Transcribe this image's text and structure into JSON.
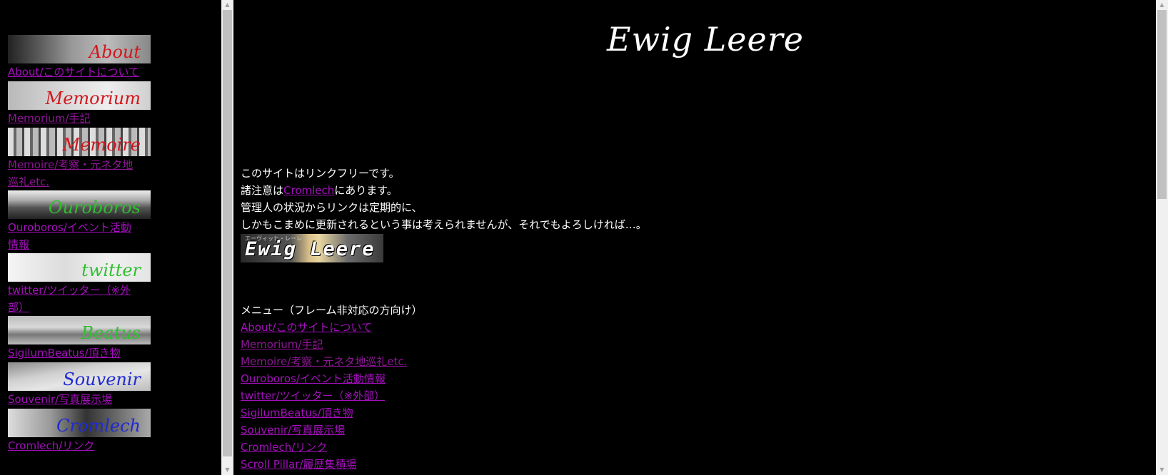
{
  "left_nav": [
    {
      "banner_text": "About",
      "banner_color": "#d0181e",
      "link": "About/このサイトについて",
      "visited": false
    },
    {
      "banner_text": "Memorium",
      "banner_color": "#d0181e",
      "link": "Memorium/手記",
      "visited": true
    },
    {
      "banner_text": "Memoire",
      "banner_color": "#d0181e",
      "link_lines": [
        "Memoire/考察・元ネタ地",
        "巡礼etc."
      ],
      "visited": true
    },
    {
      "banner_text": "Ouroboros",
      "banner_color": "#2fbf2f",
      "link_lines": [
        "Ouroboros/イベント活動",
        "情報"
      ],
      "visited": false
    },
    {
      "banner_text": "twitter",
      "banner_color": "#2fbf2f",
      "link_lines": [
        "twitter/ツイッター（※外",
        "部）"
      ],
      "visited": false
    },
    {
      "banner_text": "Beatus",
      "banner_color": "#2fbf2f",
      "link": "SigilumBeatus/頂き物",
      "visited": false
    },
    {
      "banner_text": "Souvenir",
      "banner_color": "#1f2ad0",
      "link": "Souvenir/写真展示場",
      "visited": false
    },
    {
      "banner_text": "Cromlech",
      "banner_color": "#1f2ad0",
      "link": "Cromlech/リンク",
      "visited": false
    }
  ],
  "main": {
    "title": "Ewig Leere",
    "intro": {
      "line1": "このサイトはリンクフリーです。",
      "line2_pre": "諸注意は",
      "line2_link": "Cromlech",
      "line2_post": "にあります。",
      "line3": "管理人の状況からリンクは定期的に、",
      "line4": "しかもこまめに更新されるという事は考えられませんが、それでもよろしければ…。"
    },
    "link_banner_text": "Ewig Leere",
    "link_banner_small": "エーヴィッヒ・レーレ",
    "menu_heading": "メニュー（フレーム非対応の方向け）",
    "menu": [
      {
        "label": "About/このサイトについて",
        "visited": false
      },
      {
        "label": "Memorium/手記",
        "visited": true
      },
      {
        "label": "Memoire/考察・元ネタ地巡礼etc.",
        "visited": true
      },
      {
        "label": "Ouroboros/イベント活動情報",
        "visited": false
      },
      {
        "label": "twitter/ツイッター（※外部）",
        "visited": false
      },
      {
        "label": "SigilumBeatus/頂き物",
        "visited": false
      },
      {
        "label": "Souvenir/写真展示場",
        "visited": false
      },
      {
        "label": "Cromlech/リンク",
        "visited": false
      },
      {
        "label": "Scroll Pillar/履歴集積場",
        "visited": false
      }
    ]
  },
  "colors": {
    "link": "#a40fbd",
    "visited": "#8e1596",
    "background": "#000000",
    "text": "#ffffff"
  }
}
